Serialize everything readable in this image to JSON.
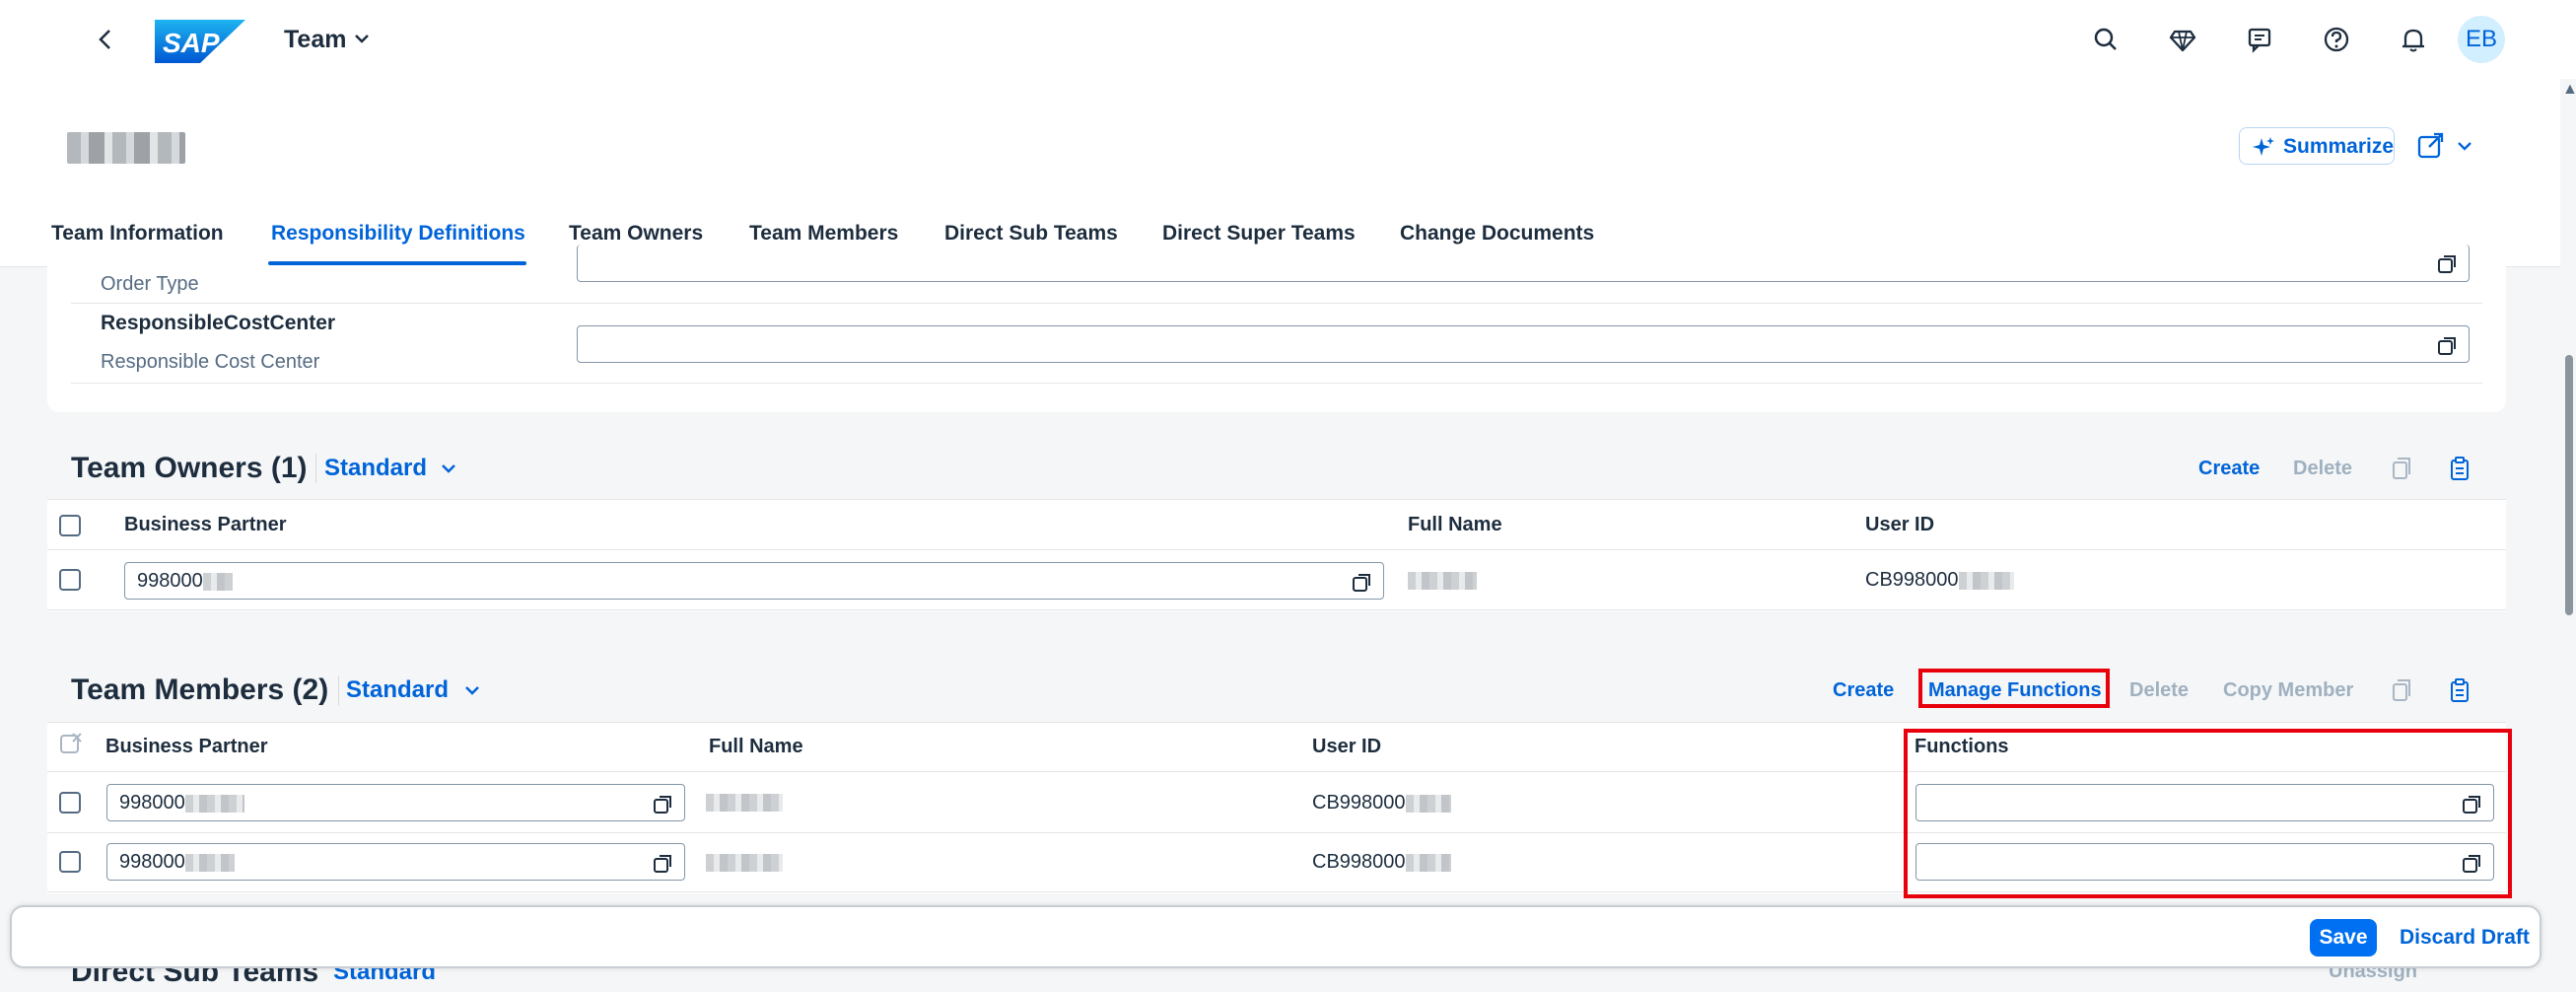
{
  "shell": {
    "back_icon": "chevron-left-icon",
    "logo_text": "SAP",
    "title": "Team",
    "avatar_initials": "EB",
    "icons": [
      "search-icon",
      "diamond-icon",
      "notes-icon",
      "help-icon",
      "bell-icon"
    ]
  },
  "header": {
    "summarize_label": "Summarize"
  },
  "tabs": [
    {
      "label": "Team Information"
    },
    {
      "label": "Responsibility Definitions"
    },
    {
      "label": "Team Owners"
    },
    {
      "label": "Team Members"
    },
    {
      "label": "Direct Sub Teams"
    },
    {
      "label": "Direct Super Teams"
    },
    {
      "label": "Change Documents"
    }
  ],
  "responsibility": {
    "order_type_label": "Order Type",
    "cost_center_technical": "ResponsibleCostCenter",
    "cost_center_label": "Responsible Cost Center"
  },
  "team_owners": {
    "title": "Team Owners (1)",
    "variant": "Standard",
    "actions": {
      "create": "Create",
      "delete": "Delete"
    },
    "columns": [
      "Business Partner",
      "Full Name",
      "User ID"
    ],
    "rows": [
      {
        "business_partner": "998000",
        "user_id": "CB998000"
      }
    ]
  },
  "team_members": {
    "title": "Team Members (2)",
    "variant": "Standard",
    "actions": {
      "create": "Create",
      "manage_functions": "Manage Functions",
      "delete": "Delete",
      "copy_member": "Copy Member"
    },
    "columns": [
      "Business Partner",
      "Full Name",
      "User ID",
      "Functions"
    ],
    "rows": [
      {
        "business_partner": "998000",
        "user_id": "CB998000"
      },
      {
        "business_partner": "998000",
        "user_id": "CB998000"
      }
    ]
  },
  "sub_teams": {
    "title": "Direct Sub Teams",
    "variant": "Standard",
    "unassign": "Unassign"
  },
  "footer": {
    "save": "Save",
    "discard": "Discard Draft"
  },
  "colors": {
    "accent": "#0064d9",
    "highlight": "#e8000d",
    "save_button": "#0070f2"
  }
}
